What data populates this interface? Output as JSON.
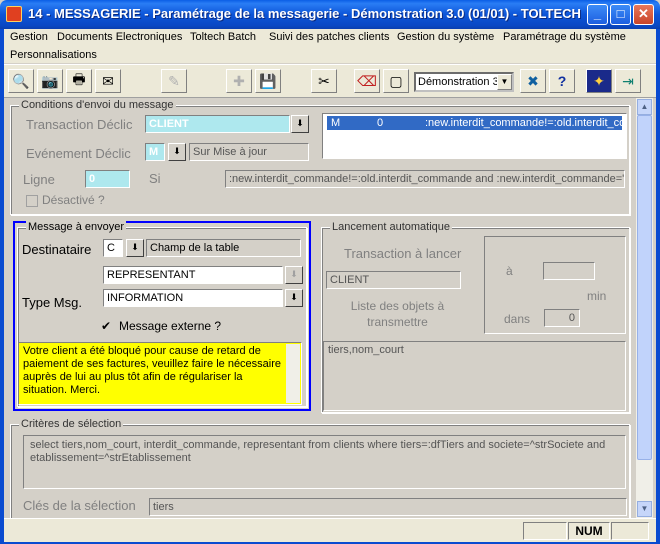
{
  "window": {
    "title": "14 - MESSAGERIE - Paramétrage de la messagerie - Démonstration 3.0 (01/01) - TOLTECH",
    "minimize": "_",
    "maximize": "□",
    "close": "✕"
  },
  "menu": {
    "items": [
      "Gestion",
      "Documents Electroniques",
      "Toltech Batch",
      "Suivi des patches clients",
      "Gestion du système",
      "Paramétrage du système",
      "Personnalisations"
    ]
  },
  "toolbar": {
    "company": "Démonstration 3"
  },
  "conditions": {
    "legend": "Conditions d'envoi du message",
    "transaction_label": "Transaction Déclic",
    "transaction_value": "CLIENT",
    "event_label": "Evénement Déclic",
    "event_code": "M",
    "event_desc": "Sur Mise à jour",
    "line_label": "Ligne",
    "line_value": "0",
    "si_label": "Si",
    "si_value": ":new.interdit_commande!=:old.interdit_commande and :new.interdit_commande='O'",
    "disabled_label": "Désactivé ?",
    "list_row": {
      "type": "M",
      "line": "0",
      "condition": ":new.interdit_commande!=:old.interdit_commande"
    }
  },
  "message": {
    "legend": "Message à envoyer",
    "recipient_label": "Destinataire",
    "recipient_code": "C",
    "recipient_desc": "Champ de la table",
    "recipient_field": "REPRESENTANT",
    "type_label": "Type Msg.",
    "type_value": "INFORMATION",
    "external_label": "Message externe ?",
    "body": "Votre client a été bloqué pour cause de retard de paiement de ses factures, veuillez faire le nécessaire auprès de lui au plus tôt afin de régulariser la situation. Merci."
  },
  "launch": {
    "legend": "Lancement automatique",
    "transaction_label": "Transaction à lancer",
    "transaction_value": "CLIENT",
    "objects_label": "Liste des objets à transmettre",
    "objects_value": "tiers,nom_court",
    "at_label": "à",
    "minutes_label": "min",
    "in_label": "dans",
    "in_value": "0"
  },
  "criteria": {
    "legend": "Critères de sélection",
    "query": "select tiers,nom_court, interdit_commande, representant from clients where tiers=:dfTiers and societe=^strSociete and etablissement=^strEtablissement",
    "keys_label": "Clés de la sélection",
    "keys_value": "tiers"
  },
  "status": {
    "num": "NUM"
  },
  "colors": {
    "title_blue": "#0a55d8",
    "highlight_cyan": "#aee8ee",
    "message_yellow": "#ffff00",
    "focus_border": "#0000ff"
  }
}
